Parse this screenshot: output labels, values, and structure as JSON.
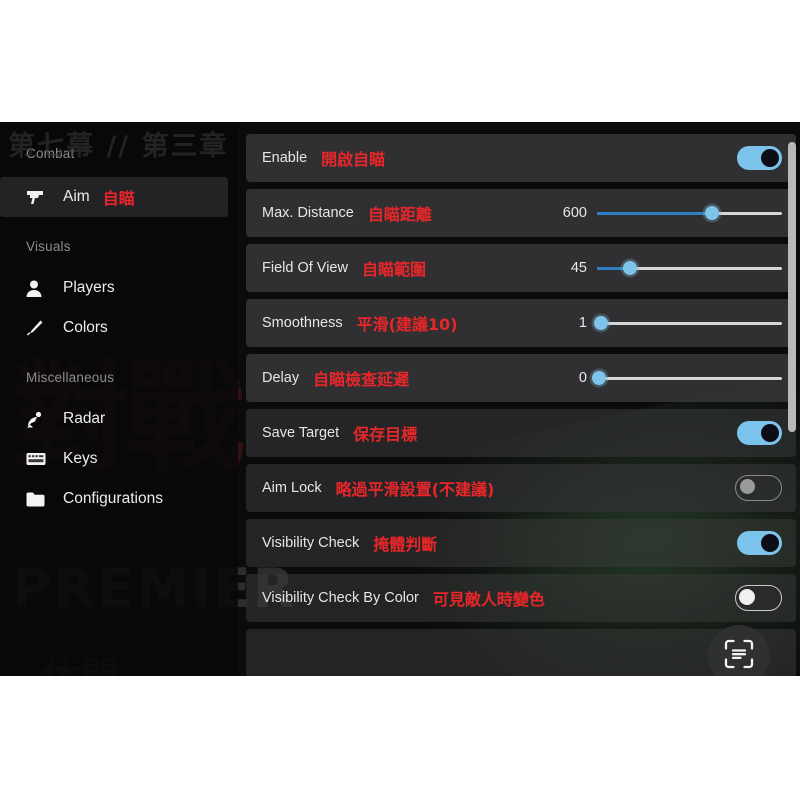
{
  "background": {
    "chapter_watermark": "第七幕 // 第三章",
    "red_watermark": "對戰",
    "premier_watermark": "PREMIER",
    "bottom_watermark": "休閒"
  },
  "sidebar": {
    "sections": [
      {
        "heading": "Combat",
        "items": [
          {
            "label": "Aim",
            "cn": "自瞄",
            "icon": "pistol-icon",
            "active": true
          }
        ]
      },
      {
        "heading": "Visuals",
        "items": [
          {
            "label": "Players",
            "cn": "",
            "icon": "person-icon",
            "active": false
          },
          {
            "label": "Colors",
            "cn": "",
            "icon": "brush-icon",
            "active": false
          }
        ]
      },
      {
        "heading": "Miscellaneous",
        "items": [
          {
            "label": "Radar",
            "cn": "",
            "icon": "satellite-dish-icon",
            "active": false
          },
          {
            "label": "Keys",
            "cn": "",
            "icon": "keyboard-icon",
            "active": false
          },
          {
            "label": "Configurations",
            "cn": "",
            "icon": "folder-icon",
            "active": false
          }
        ]
      }
    ]
  },
  "panel": {
    "rows": [
      {
        "label": "Enable",
        "cn": "開啟自瞄",
        "control": "toggle",
        "state": "on"
      },
      {
        "label": "Max. Distance",
        "cn": "自瞄距離",
        "control": "slider",
        "value": "600",
        "fill_percent": 62
      },
      {
        "label": "Field Of View",
        "cn": "自瞄範圍",
        "control": "slider",
        "value": "45",
        "fill_percent": 18
      },
      {
        "label": "Smoothness",
        "cn": "平滑(建議10)",
        "control": "slider",
        "value": "1",
        "fill_percent": 2
      },
      {
        "label": "Delay",
        "cn": "自瞄檢查延遲",
        "control": "slider",
        "value": "0",
        "fill_percent": 1
      },
      {
        "label": "Save Target",
        "cn": "保存目標",
        "control": "toggle",
        "state": "on"
      },
      {
        "label": "Aim Lock",
        "cn": "略過平滑設置(不建議)",
        "control": "toggle",
        "state": "outline"
      },
      {
        "label": "Visibility Check",
        "cn": "掩體判斷",
        "control": "toggle",
        "state": "on"
      },
      {
        "label": "Visibility Check By Color",
        "cn": "可見敵人時變色",
        "control": "toggle",
        "state": "off"
      }
    ]
  },
  "overlay": {
    "scan_button_icon": "text-scan-icon"
  },
  "colors": {
    "accent_blue": "#3e8fd0",
    "toggle_on": "#7cc3ec",
    "slider_knob": "#7fc4e8",
    "slider_fill": "#2f7fc4",
    "annotation_red": "#e8262a",
    "row_bg": "#343436",
    "panel_bg": "#0b0b0c"
  }
}
